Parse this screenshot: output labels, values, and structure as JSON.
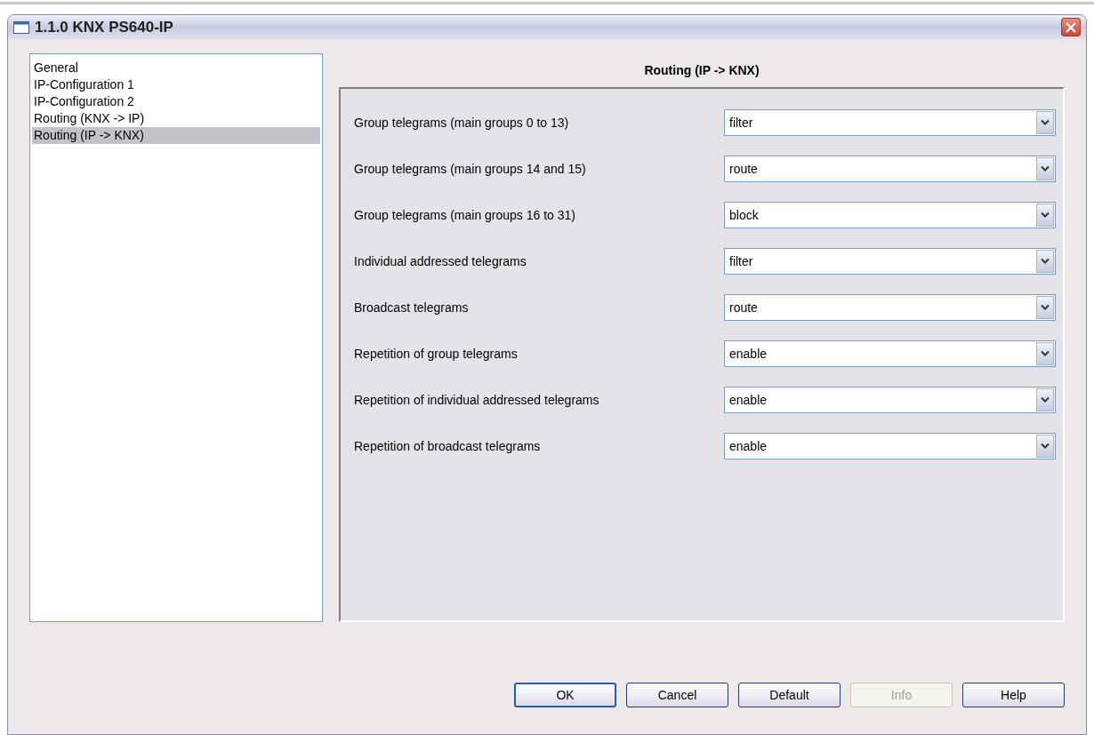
{
  "window": {
    "title": "1.1.0 KNX PS640-IP"
  },
  "sidebar": {
    "items": [
      {
        "label": "General",
        "selected": false
      },
      {
        "label": "IP-Configuration 1",
        "selected": false
      },
      {
        "label": "IP-Configuration 2",
        "selected": false
      },
      {
        "label": "Routing (KNX -> IP)",
        "selected": false
      },
      {
        "label": "Routing (IP -> KNX)",
        "selected": true
      }
    ]
  },
  "panel": {
    "title": "Routing (IP -> KNX)",
    "parameters": [
      {
        "label": "Group telegrams (main groups 0 to 13)",
        "value": "filter"
      },
      {
        "label": "Group telegrams (main groups 14 and 15)",
        "value": "route"
      },
      {
        "label": "Group telegrams (main groups 16 to 31)",
        "value": "block"
      },
      {
        "label": "Individual addressed telegrams",
        "value": "filter"
      },
      {
        "label": "Broadcast telegrams",
        "value": "route"
      },
      {
        "label": "Repetition of group telegrams",
        "value": "enable"
      },
      {
        "label": "Repetition of individual addressed telegrams",
        "value": "enable"
      },
      {
        "label": "Repetition of broadcast telegrams",
        "value": "enable"
      }
    ]
  },
  "buttons": [
    {
      "label": "OK",
      "disabled": false,
      "default": true
    },
    {
      "label": "Cancel",
      "disabled": false,
      "default": false
    },
    {
      "label": "Default",
      "disabled": false,
      "default": false
    },
    {
      "label": "Info",
      "disabled": true,
      "default": false
    },
    {
      "label": "Help",
      "disabled": false,
      "default": false
    }
  ]
}
